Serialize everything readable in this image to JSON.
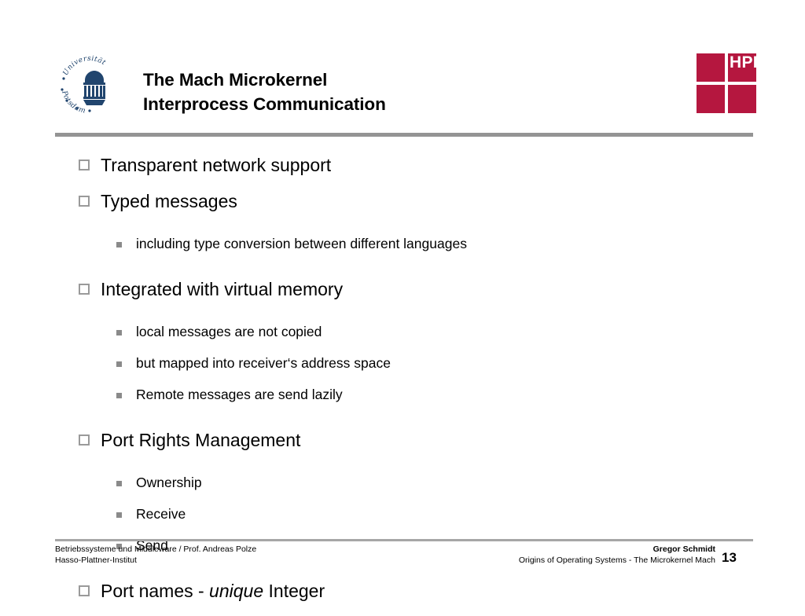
{
  "header": {
    "title_line1": "The Mach Microkernel",
    "title_line2": "Interprocess Communication",
    "university_logo_text_top": "Universität",
    "university_logo_text_bottom": "Potsdam",
    "hpi_logo_text": "HPI",
    "hpi_red": "#b5173f",
    "rule_color": "#949494"
  },
  "body": {
    "bullets": [
      {
        "level": 1,
        "text": "Transparent network support"
      },
      {
        "level": 1,
        "text": "Typed messages"
      },
      {
        "level": 2,
        "text": "including type conversion between different languages"
      },
      {
        "level": 1,
        "text": "Integrated with virtual memory"
      },
      {
        "level": 2,
        "text": "local messages are not copied"
      },
      {
        "level": 2,
        "text": "but mapped into receiver‘s address space"
      },
      {
        "level": 2,
        "text": "Remote messages are send lazily"
      },
      {
        "level": 1,
        "text": "Port Rights Management"
      },
      {
        "level": 2,
        "text": "Ownership"
      },
      {
        "level": 2,
        "text": "Receive"
      },
      {
        "level": 2,
        "text": "Send"
      }
    ],
    "last_bullet": {
      "prefix": "Port names - ",
      "emphasis": "unique",
      "suffix": " Integer"
    }
  },
  "footer": {
    "left_line1": "Betriebssysteme und Middleware / Prof. Andreas Polze",
    "left_line2": "Hasso-Plattner-Institut",
    "author": "Gregor Schmidt",
    "subject": "Origins of Operating Systems - The Microkernel Mach",
    "page_number": "13",
    "rule_color": "#a6a6a6"
  }
}
